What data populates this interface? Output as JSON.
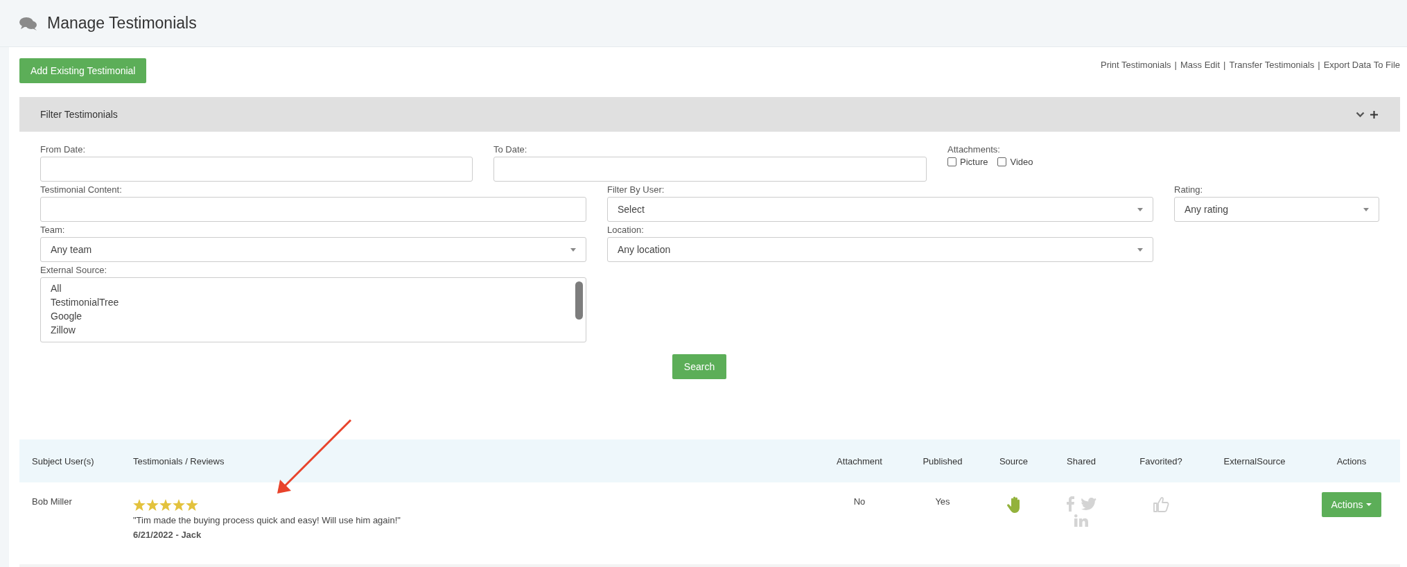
{
  "header": {
    "title": "Manage Testimonials"
  },
  "toolbar": {
    "add_button": "Add Existing Testimonial",
    "separator": "|",
    "links": [
      {
        "label": "Print Testimonials"
      },
      {
        "label": "Mass Edit"
      },
      {
        "label": "Transfer Testimonials"
      },
      {
        "label": "Export Data To File"
      }
    ]
  },
  "filter": {
    "title": "Filter Testimonials",
    "from_date": {
      "label": "From Date:"
    },
    "to_date": {
      "label": "To Date:"
    },
    "attachments": {
      "label": "Attachments:",
      "options": [
        {
          "label": "Picture",
          "checked": false
        },
        {
          "label": "Video",
          "checked": false
        }
      ]
    },
    "testimonial_content": {
      "label": "Testimonial Content:"
    },
    "filter_by_user": {
      "label": "Filter By User:",
      "value": "Select"
    },
    "rating": {
      "label": "Rating:",
      "value": "Any rating"
    },
    "team": {
      "label": "Team:",
      "value": "Any team"
    },
    "location": {
      "label": "Location:",
      "value": "Any location"
    },
    "external_source": {
      "label": "External Source:",
      "options": [
        "All",
        "TestimonialTree",
        "Google",
        "Zillow"
      ]
    },
    "search_button": "Search"
  },
  "table": {
    "columns": [
      "Subject User(s)",
      "Testimonials / Reviews",
      "Attachment",
      "Published",
      "Source",
      "Shared",
      "Favorited?",
      "ExternalSource",
      "Actions"
    ],
    "rows": [
      {
        "subject": "Bob Miller",
        "stars": 5,
        "review": "\"Tim made the buying process quick and easy! Will use him again!\"",
        "meta": "6/21/2022 - Jack",
        "attachment": "No",
        "published": "Yes",
        "favorited": false,
        "actions": "Actions"
      }
    ]
  }
}
